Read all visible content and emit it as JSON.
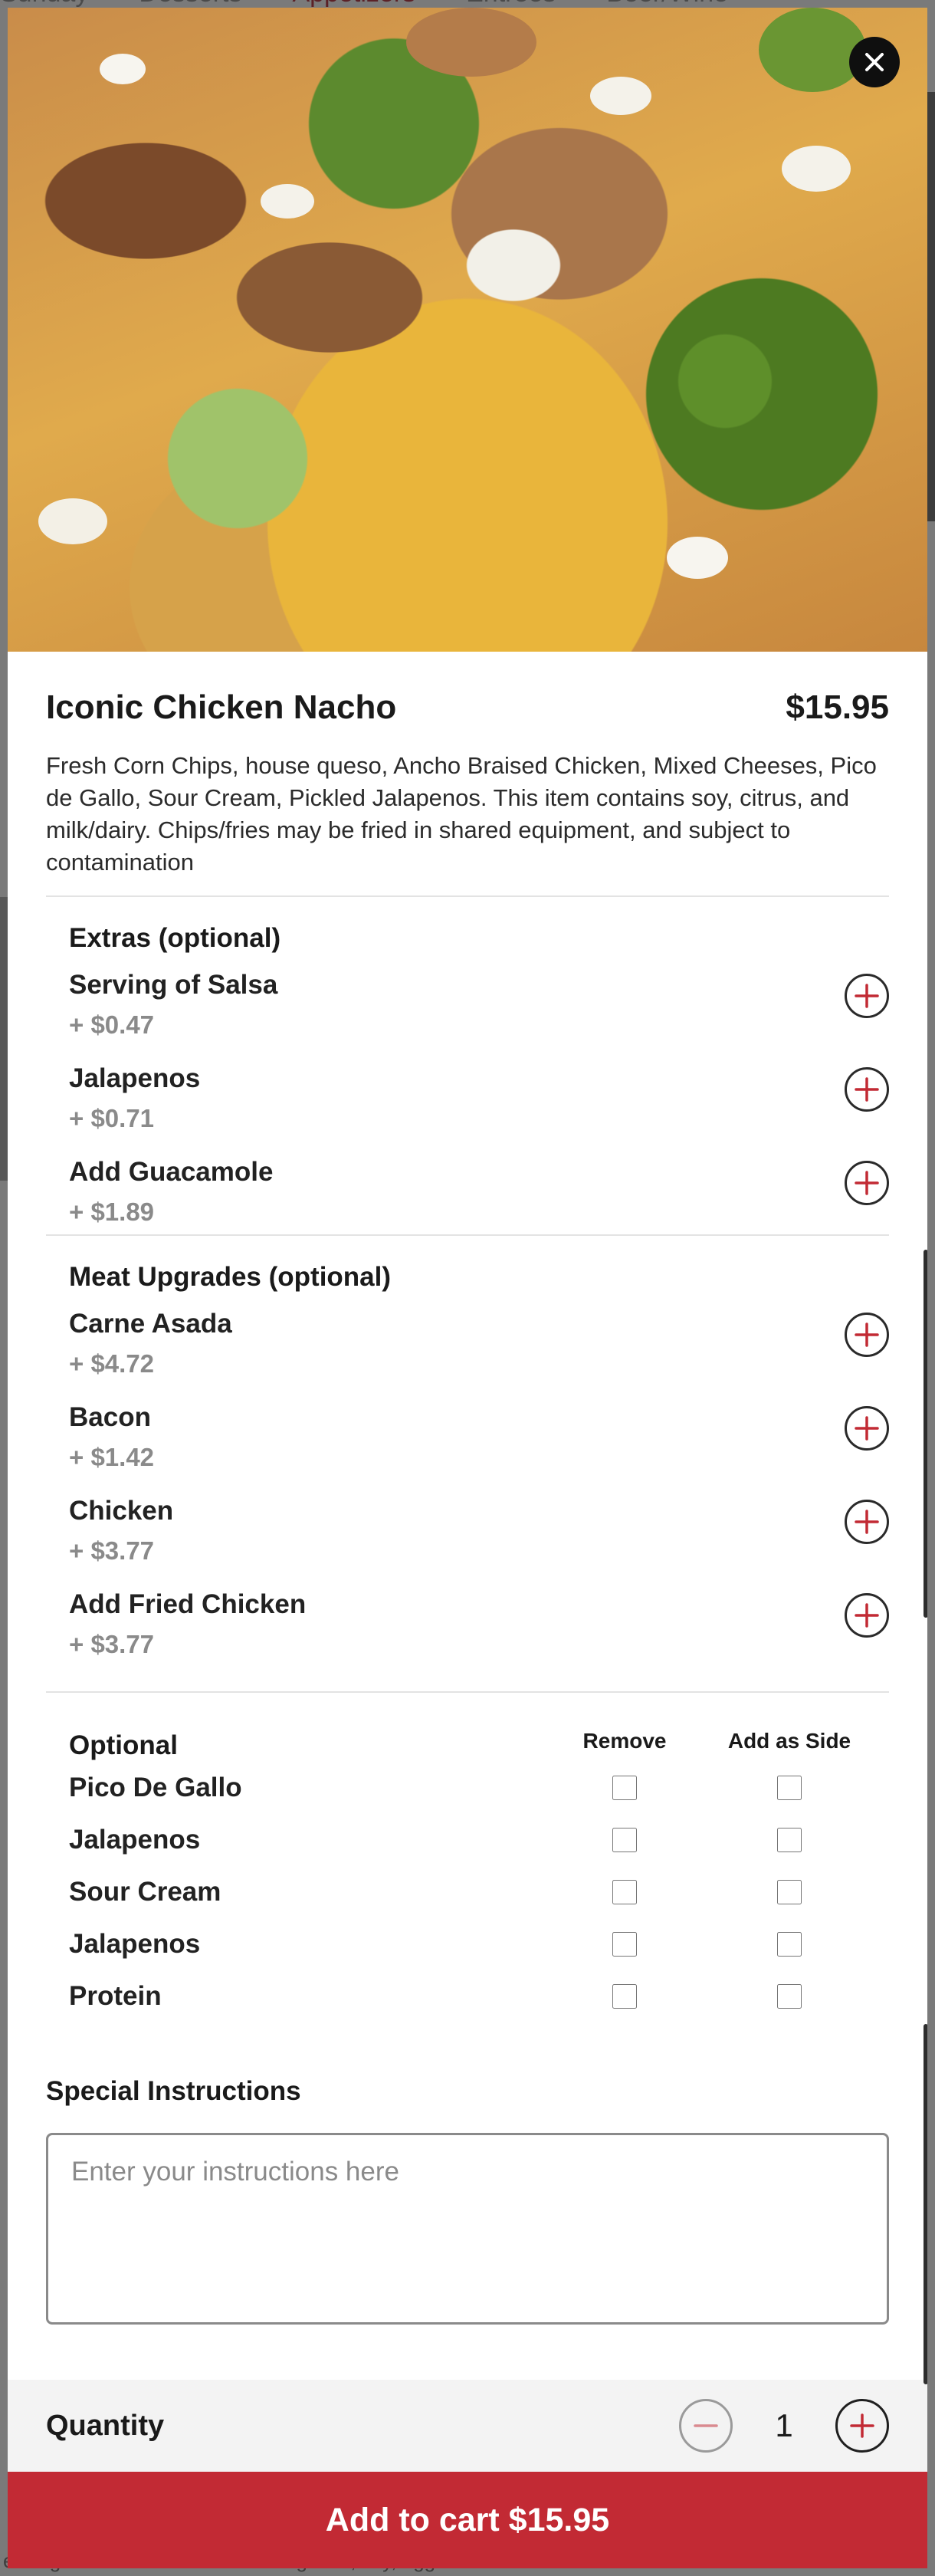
{
  "background": {
    "nav_tabs": [
      "Sunday",
      "Desserts",
      "Appetizers",
      "Entrees",
      "Beer/Wine"
    ],
    "footer_snippet": "essing. This item contains wheat/gluten, soy, egg..."
  },
  "item": {
    "title": "Iconic Chicken Nacho",
    "price": "$15.95",
    "description": "Fresh Corn Chips, house queso, Ancho Braised Chicken, Mixed Cheeses, Pico de Gallo, Sour Cream, Pickled Jalapenos. This item contains soy, citrus, and milk/dairy. Chips/fries may be fried in shared equipment, and subject to contamination"
  },
  "extras": {
    "title": "Extras (optional)",
    "options": [
      {
        "name": "Serving of Salsa",
        "price": "+ $0.47"
      },
      {
        "name": "Jalapenos",
        "price": "+ $0.71"
      },
      {
        "name": "Add Guacamole",
        "price": "+ $1.89"
      }
    ]
  },
  "meat_upgrades": {
    "title": "Meat Upgrades (optional)",
    "options": [
      {
        "name": "Carne Asada",
        "price": "+ $4.72"
      },
      {
        "name": "Bacon",
        "price": "+ $1.42"
      },
      {
        "name": "Chicken",
        "price": "+ $3.77"
      },
      {
        "name": "Add Fried Chicken",
        "price": "+ $3.77"
      }
    ]
  },
  "optional": {
    "title": "Optional",
    "col_remove": "Remove",
    "col_side": "Add as Side",
    "rows": [
      "Pico De Gallo",
      "Jalapenos",
      "Sour Cream",
      "Jalapenos",
      "Protein"
    ]
  },
  "special": {
    "title": "Special Instructions",
    "placeholder": "Enter your instructions here"
  },
  "quantity": {
    "label": "Quantity",
    "value": "1"
  },
  "cart": {
    "label": "Add to cart $15.95"
  },
  "colors": {
    "accent": "#c22a34",
    "text": "#1a1a1a",
    "muted": "#8a8a8a"
  },
  "icons": {
    "close": "close-icon",
    "add": "plus-circle-icon",
    "remove": "minus-circle-icon"
  }
}
